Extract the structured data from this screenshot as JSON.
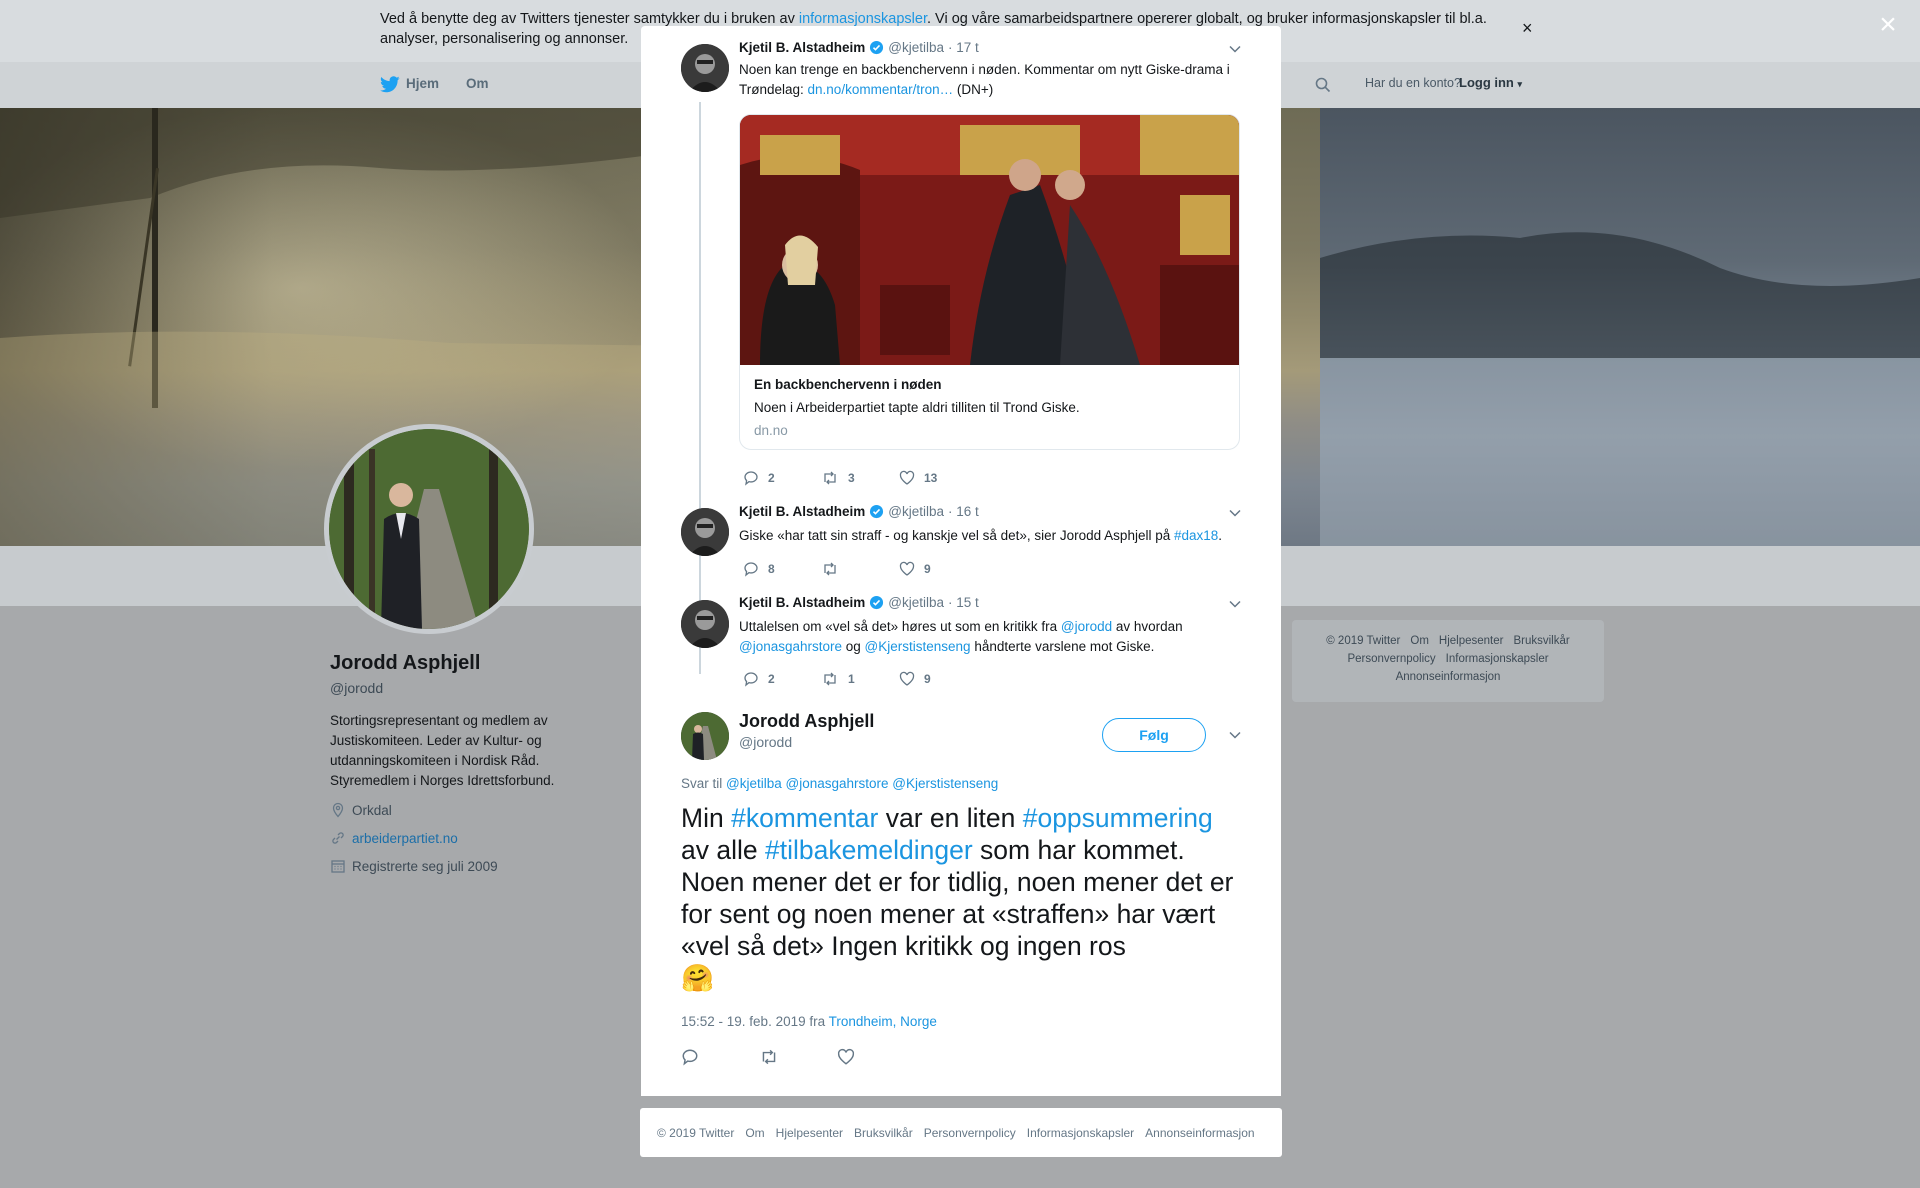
{
  "cookie": {
    "text_before": "Ved å benytte deg av Twitters tjenester samtykker du i bruken av ",
    "link": "informasjonskapsler",
    "text_after": ". Vi og våre samarbeidspartnere opererer globalt, og bruker informasjonskapsler til bl.a. analyser, personalisering og annonser.",
    "close": "×"
  },
  "nav": {
    "home": "Hjem",
    "about": "Om",
    "login_question": "Har du en konto?",
    "login": "Logg inn"
  },
  "profile": {
    "name": "Jorodd Asphjell",
    "handle": "@jorodd",
    "bio": "Stortingsrepresentant og medlem av Justiskomiteen. Leder av Kultur- og utdanningskomiteen i Nordisk Råd. Styremedlem i Norges Idrettsforbund.",
    "location": "Orkdal",
    "website": "arbeiderpartiet.no",
    "joined": "Registrerte seg juli 2009"
  },
  "side_footer": [
    "© 2019 Twitter",
    "Om",
    "Hjelpesenter",
    "Bruksvilkår",
    "Personvernpolicy",
    "Informasjonskapsler",
    "Annonseinformasjon"
  ],
  "modal": {
    "close": "×",
    "tweets": [
      {
        "name": "Kjetil B. Alstadheim",
        "handle": "@kjetilba",
        "time": "· 17 t",
        "text_before": "Noen kan trenge en backbenchervenn i nøden. Kommentar om nytt Giske-drama i Trøndelag: ",
        "link": "dn.no/kommentar/tron…",
        "text_after": " (DN+)",
        "card": {
          "title": "En backbenchervenn i nøden",
          "description": "Noen i Arbeiderpartiet tapte aldri tilliten til Trond Giske.",
          "domain": "dn.no"
        },
        "replies": "2",
        "retweets": "3",
        "likes": "13"
      },
      {
        "name": "Kjetil B. Alstadheim",
        "handle": "@kjetilba",
        "time": "· 16 t",
        "text_before": "Giske «har tatt sin straff - og kanskje vel så det», sier Jorodd Asphjell på ",
        "hashtag": "#dax18",
        "text_after": ".",
        "replies": "8",
        "retweets": "",
        "likes": "9"
      },
      {
        "name": "Kjetil B. Alstadheim",
        "handle": "@kjetilba",
        "time": "· 15 t",
        "text_1": "Uttalelsen om «vel så det» høres ut som en kritikk fra ",
        "mention_1": "@jorodd",
        "text_2": " av hvordan",
        "mention_2": "@jonasgahrstore",
        "text_3": " og ",
        "mention_3": "@Kjerstistenseng",
        "text_4": " håndterte varslene mot Giske.",
        "replies": "2",
        "retweets": "1",
        "likes": "9"
      }
    ],
    "main": {
      "name": "Jorodd Asphjell",
      "handle": "@jorodd",
      "follow": "Følg",
      "replying_label": "Svar til ",
      "replying_to": [
        "@kjetilba",
        "@jonasgahrstore",
        "@Kjerstistenseng"
      ],
      "t1": "Min ",
      "h1": "#kommentar",
      "t2": " var en liten ",
      "h2": "#oppsummering",
      "t3": " av alle ",
      "h3": "#tilbakemeldinger",
      "t4": " som har kommet. Noen mener det er for tidlig, noen mener det er for sent og noen mener at «straffen» har vært «vel så det» Ingen kritikk og ingen ros ",
      "emoji": "🤗",
      "time": "15:52 - 19. feb. 2019 fra ",
      "place": "Trondheim, Norge"
    }
  },
  "bottom_footer": [
    "© 2019 Twitter",
    "Om",
    "Hjelpesenter",
    "Bruksvilkår",
    "Personvernpolicy",
    "Informasjonskapsler",
    "Annonseinformasjon"
  ],
  "colors": {
    "link": "#1b95e0",
    "follow": "#1da1f2",
    "verified": "#1da1f2"
  }
}
